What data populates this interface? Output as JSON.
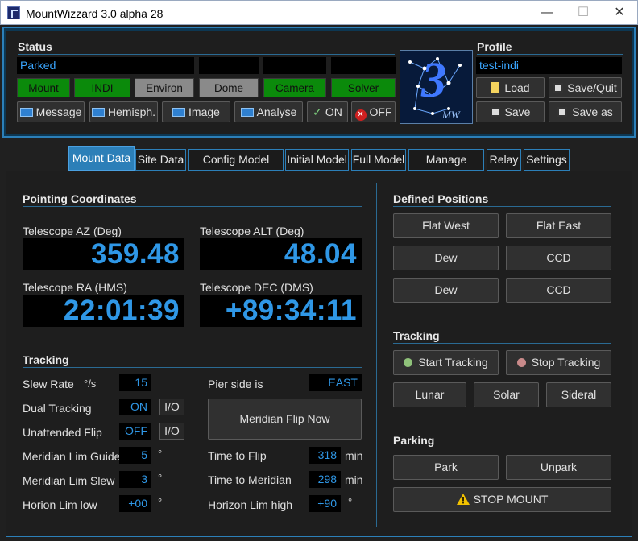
{
  "window": {
    "title": "MountWizzard 3.0 alpha 28",
    "minimize": "—",
    "maximize": "☐",
    "close": "✕"
  },
  "status": {
    "heading": "Status",
    "field1": "Parked",
    "field2": "",
    "field3": "",
    "field4": "",
    "indicators": [
      {
        "label": "Mount",
        "state": "green"
      },
      {
        "label": "INDI",
        "state": "green"
      },
      {
        "label": "Environ",
        "state": "gray"
      },
      {
        "label": "Dome",
        "state": "gray"
      },
      {
        "label": "Camera",
        "state": "green"
      },
      {
        "label": "Solver",
        "state": "green"
      }
    ],
    "buttons": {
      "message": "Message",
      "hemisph": "Hemisph.",
      "image": "Image",
      "analyse": "Analyse",
      "on": "ON",
      "off": "OFF"
    }
  },
  "profile": {
    "heading": "Profile",
    "name": "test-indi",
    "load": "Load",
    "save_quit": "Save/Quit",
    "save": "Save",
    "save_as": "Save as"
  },
  "logo": {
    "text": "3",
    "sub": "MW"
  },
  "tabs": [
    "Mount Data",
    "Site Data",
    "Config Model Build",
    "Initial Model",
    "Full Model",
    "Manage Model",
    "Relay",
    "Settings"
  ],
  "pointing": {
    "heading": "Pointing Coordinates",
    "az_label": "Telescope AZ (Deg)",
    "az": "359.48",
    "alt_label": "Telescope ALT (Deg)",
    "alt": "48.04",
    "ra_label": "Telescope RA (HMS)",
    "ra": "22:01:39",
    "dec_label": "Telescope DEC (DMS)",
    "dec": "+89:34:11"
  },
  "tracking_left": {
    "heading": "Tracking",
    "slew_rate_label": "Slew Rate",
    "slew_rate_unit": "°/s",
    "slew_rate": "15",
    "dual_label": "Dual Tracking",
    "dual": "ON",
    "dual_io": "I/O",
    "unattended_label": "Unattended Flip",
    "unattended": "OFF",
    "unattended_io": "I/O",
    "mlg_label": "Meridian Lim Guide",
    "mlg": "5",
    "mlg_unit": "°",
    "mls_label": "Meridian Lim Slew",
    "mls": "3",
    "mls_unit": "°",
    "hll_label": "Horion Lim low",
    "hll": "+00",
    "hll_unit": "°",
    "pier_label": "Pier side is",
    "pier": "EAST",
    "flip_now": "Meridian Flip Now",
    "ttf_label": "Time to Flip",
    "ttf": "318",
    "ttf_unit": "min",
    "ttm_label": "Time to Meridian",
    "ttm": "298",
    "ttm_unit": "min",
    "hlh_label": "Horizon Lim high",
    "hlh": "+90",
    "hlh_unit": "°"
  },
  "defined_positions": {
    "heading": "Defined Positions",
    "buttons": [
      "Flat West",
      "Flat East",
      "Dew",
      "CCD",
      "Dew",
      "CCD"
    ]
  },
  "tracking_right": {
    "heading": "Tracking",
    "start": "Start Tracking",
    "stop": "Stop Tracking",
    "lunar": "Lunar",
    "solar": "Solar",
    "sidereal": "Sideral"
  },
  "parking": {
    "heading": "Parking",
    "park": "Park",
    "unpark": "Unpark",
    "stop_mount": "STOP MOUNT"
  },
  "colors": {
    "accent": "#2c7fb8",
    "value_blue": "#2f97e6",
    "indicator_green": "#0b8a0b",
    "indicator_gray": "#8a8a8a"
  }
}
